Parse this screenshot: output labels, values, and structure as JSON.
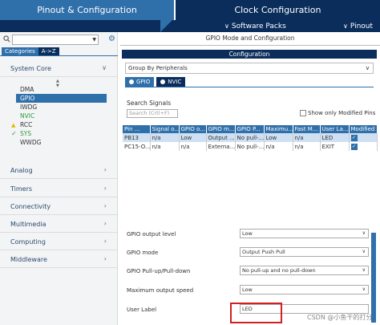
{
  "top_tabs": {
    "pinout": "Pinout & Configuration",
    "clock": "Clock Configuration"
  },
  "subbar": {
    "software_packs": "Software Packs",
    "pinout": "Pinout"
  },
  "left": {
    "category_tabs": [
      "Categories",
      "A->Z"
    ],
    "system_core": "System Core",
    "items": [
      "DMA",
      "GPIO",
      "IWDG",
      "NVIC",
      "RCC",
      "SYS",
      "WWDG"
    ],
    "groups": [
      "Analog",
      "Timers",
      "Connectivity",
      "Multimedia",
      "Computing",
      "Middleware"
    ]
  },
  "right": {
    "title": "GPIO Mode and Configuration",
    "config_bar": "Configuration",
    "group_by": "Group By Peripherals",
    "tabs": [
      "GPIO",
      "NVIC"
    ],
    "search_label": "Search Signals",
    "search_placeholder": "Search (Crtl+F)",
    "show_modified": "Show only Modified Pins",
    "table": {
      "headers": [
        "Pin ...",
        "Signal o...",
        "GPIO o...",
        "GPIO m...",
        "GPIO P...",
        "Maximu...",
        "Fast M...",
        "User La...",
        "Modified"
      ],
      "rows": [
        [
          "PB13",
          "n/a",
          "Low",
          "Output ...",
          "No pull-...",
          "Low",
          "n/a",
          "LED",
          "✓"
        ],
        [
          "PC15-O...",
          "n/a",
          "n/a",
          "Externa...",
          "No pull-...",
          "n/a",
          "n/a",
          "EXIT",
          "✓"
        ]
      ]
    },
    "props": [
      {
        "label": "GPIO output level",
        "value": "Low"
      },
      {
        "label": "GPIO mode",
        "value": "Output Push Pull"
      },
      {
        "label": "GPIO Pull-up/Pull-down",
        "value": "No pull-up and no pull-down"
      },
      {
        "label": "Maximum output speed",
        "value": "Low"
      },
      {
        "label": "User Label",
        "value": "LED"
      }
    ]
  },
  "watermark": "CSDN @小鱼干的打分",
  "colors": {
    "primary": "#2f6faa",
    "dark": "#0a2d5c",
    "highlight": "#d21f1f"
  }
}
